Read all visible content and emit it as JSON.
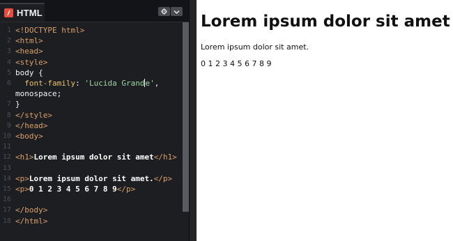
{
  "editor": {
    "tab_label": "HTML",
    "tab_icon": "html-logo-icon",
    "tab_color": "#e74c3c",
    "controls": [
      "gear-icon",
      "chevron-down-icon"
    ],
    "lines": [
      {
        "n": "1",
        "parts": [
          [
            "tag",
            "<!DOCTYPE html>"
          ]
        ]
      },
      {
        "n": "2",
        "parts": [
          [
            "tag",
            "<html>"
          ]
        ]
      },
      {
        "n": "3",
        "parts": [
          [
            "tag",
            "<head>"
          ]
        ]
      },
      {
        "n": "4",
        "parts": [
          [
            "tag",
            "<style>"
          ]
        ]
      },
      {
        "n": "5",
        "parts": [
          [
            "plain",
            "body {"
          ]
        ]
      },
      {
        "n": "6",
        "parts": [
          [
            "plain",
            "  "
          ],
          [
            "prop",
            "font-family"
          ],
          [
            "plain",
            ": "
          ],
          [
            "str",
            "'Lucida Grande'"
          ],
          [
            "plain",
            ","
          ]
        ]
      },
      {
        "n": "",
        "parts": [
          [
            "plain",
            "monospace;"
          ]
        ]
      },
      {
        "n": "7",
        "parts": [
          [
            "plain",
            "}"
          ]
        ]
      },
      {
        "n": "8",
        "parts": [
          [
            "tag",
            "</style>"
          ]
        ]
      },
      {
        "n": "9",
        "parts": [
          [
            "tag",
            "</head>"
          ]
        ]
      },
      {
        "n": "10",
        "parts": [
          [
            "tag",
            "<body>"
          ]
        ]
      },
      {
        "n": "11",
        "parts": []
      },
      {
        "n": "12",
        "parts": [
          [
            "tag",
            "<h1>"
          ],
          [
            "txt",
            "Lorem ipsum dolor sit amet"
          ],
          [
            "tag",
            "</h1>"
          ]
        ]
      },
      {
        "n": "13",
        "parts": []
      },
      {
        "n": "14",
        "parts": [
          [
            "tag",
            "<p>"
          ],
          [
            "txt",
            "Lorem ipsum dolor sit amet."
          ],
          [
            "tag",
            "</p>"
          ]
        ]
      },
      {
        "n": "15",
        "parts": [
          [
            "tag",
            "<p>"
          ],
          [
            "txt",
            "0 1 2 3 4 5 6 7 8 9"
          ],
          [
            "tag",
            "</p>"
          ]
        ]
      },
      {
        "n": "16",
        "parts": []
      },
      {
        "n": "17",
        "parts": [
          [
            "tag",
            "</body>"
          ]
        ]
      },
      {
        "n": "18",
        "parts": [
          [
            "tag",
            "</html>"
          ]
        ]
      }
    ]
  },
  "preview": {
    "heading": "Lorem ipsum dolor sit amet",
    "paragraph": "Lorem ipsum dolor sit amet.",
    "digits": "0 1 2 3 4 5 6 7 8 9"
  }
}
